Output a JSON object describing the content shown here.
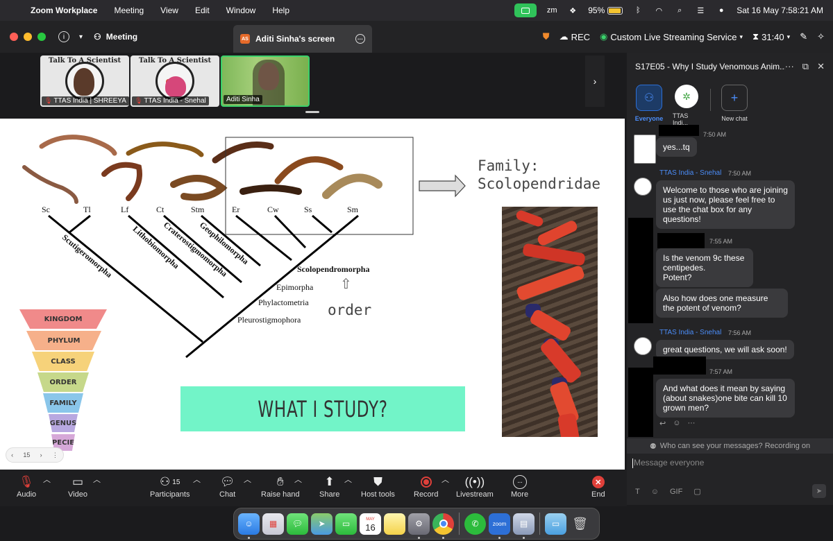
{
  "menubar": {
    "app_name": "Zoom Workplace",
    "menus": [
      "Meeting",
      "View",
      "Edit",
      "Window",
      "Help"
    ],
    "battery": "95%",
    "datetime": "Sat 16 May  7:58:21 AM"
  },
  "titlebar": {
    "meeting_label": "Meeting",
    "screen_badge": "AS",
    "screen_tab": "Aditi Sinha's screen",
    "rec_label": "REC",
    "stream_label": "Custom Live Streaming Service",
    "timer": "31:40"
  },
  "thumbnails": [
    {
      "name": "TTAS India | SHREEYA",
      "muted": true
    },
    {
      "name": "TTAS India - Snehal",
      "muted": true
    },
    {
      "name": "Aditi Sinha",
      "muted": false
    }
  ],
  "slide": {
    "taxa": [
      "Sc",
      "Tl",
      "Lf",
      "Ct",
      "Stm",
      "Er",
      "Cw",
      "Ss",
      "Sm"
    ],
    "clades": [
      "Scutigeromorpha",
      "Lithobiomorpha",
      "Craterostigmomorpha",
      "Geophilomorpha",
      "Scolopendromorpha"
    ],
    "nodes": [
      "Epimorpha",
      "Phylactometria",
      "Pleurostigmophora"
    ],
    "family_line1": "Family:",
    "family_line2": "Scolopendridae",
    "order_label": "order",
    "arrow": "⇧",
    "study_title": "WHAT I STUDY?",
    "pyramid": [
      "KINGDOM",
      "PHYLUM",
      "CLASS",
      "ORDER",
      "FAMILY",
      "GENUS",
      "SPECIES"
    ],
    "pyramid_colors": [
      "#f08a8a",
      "#f6b08a",
      "#f6d27a",
      "#c6d88a",
      "#8ac6ea",
      "#b8a8e0",
      "#d6a8d8"
    ],
    "page_number": "15"
  },
  "chat": {
    "title": "S17E05 - Why I Study Venomous Anim...",
    "channels": [
      {
        "label": "Everyone",
        "active": true
      },
      {
        "label": "TTAS Indi...",
        "active": false
      },
      {
        "label": "New chat",
        "active": false
      }
    ],
    "messages": [
      {
        "sender": "",
        "time": "7:50 AM",
        "text": "yes...tq"
      },
      {
        "sender": "TTAS India - Snehal",
        "time": "7:50 AM",
        "text": "Welcome to those who are joining us just now, please feel free to use the chat box for any questions!"
      },
      {
        "sender": "",
        "time": "7:55 AM",
        "text": "Is the venom 9c these centipedes.\n Potent?"
      },
      {
        "sender": "",
        "time": "",
        "text": "Also how does one measure the potent of venom?"
      },
      {
        "sender": "TTAS India - Snehal",
        "time": "7:56 AM",
        "text": "great questions, we will ask soon!"
      },
      {
        "sender": "",
        "time": "7:57 AM",
        "text": "And what does it mean by saying (about snakes)one bite can kill 10 grown men?"
      }
    ],
    "privacy_note": "Who can see your messages? Recording on",
    "input_placeholder": "Message everyone",
    "tools": [
      "T",
      "☺",
      "GIF",
      "▢"
    ]
  },
  "controls": [
    {
      "label": "Audio",
      "icon": "mic-muted-icon"
    },
    {
      "label": "Video",
      "icon": "camera-icon"
    },
    {
      "label": "Participants",
      "count": "15",
      "icon": "people-icon"
    },
    {
      "label": "Chat",
      "icon": "chat-icon"
    },
    {
      "label": "Raise hand",
      "icon": "hand-icon"
    },
    {
      "label": "Share",
      "icon": "share-icon"
    },
    {
      "label": "Host tools",
      "icon": "shield-icon"
    },
    {
      "label": "Record",
      "icon": "record-icon"
    },
    {
      "label": "Livestream",
      "icon": "livestream-icon"
    },
    {
      "label": "More",
      "icon": "more-icon"
    },
    {
      "label": "End",
      "icon": "end-icon"
    }
  ],
  "dock": {
    "calendar_month": "MAY",
    "calendar_day": "16",
    "zoom_label": "zoom"
  }
}
